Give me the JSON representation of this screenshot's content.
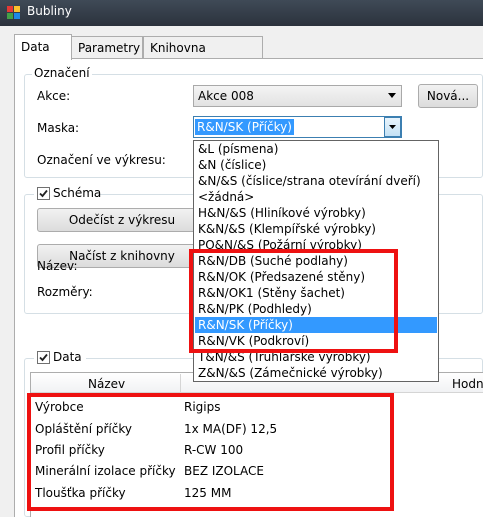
{
  "window": {
    "title": "Bubliny"
  },
  "tabs": [
    "Data",
    "Parametry",
    "Knihovna schémat"
  ],
  "oznaceni": {
    "title": "Označení",
    "akce_label": "Akce:",
    "akce_value": "Akce 008",
    "nova_button": "Nová...",
    "maska_label": "Maska:",
    "maska_value": "R&N/SK (Příčky)",
    "vykres_label": "Označení ve výkresu:"
  },
  "schema": {
    "title": "Schéma",
    "checked": true,
    "odecist_button": "Odečíst z výkresu",
    "nacist_button": "Načíst z knihovny",
    "nazev_label": "Název:",
    "rozmery_label": "Rozměry:"
  },
  "dropdown": {
    "options": [
      "&L (písmena)",
      "&N (číslice)",
      "&N/&S (číslice/strana otevírání dveří)",
      "<žádná>",
      "H&N/&S (Hliníkové výrobky)",
      "K&N/&S (Klempířské výrobky)",
      "PO&N/&S (Požární výrobky)",
      "R&N/DB (Suché podlahy)",
      "R&N/OK (Předsazené stěny)",
      "R&N/OK1 (Stěny šachet)",
      "R&N/PK (Podhledy)",
      "R&N/SK (Příčky)",
      "R&N/VK (Podkroví)",
      "T&N/&S (Truhlářské výrobky)",
      "Z&N/&S (Zámečnické výrobky)"
    ],
    "selected_index": 11
  },
  "data_section": {
    "title": "Data",
    "checked": true,
    "col_name": "Název",
    "col_value_partial": "Hodn",
    "rows": [
      {
        "name": "Výrobce",
        "value": "Rigips"
      },
      {
        "name": "Opláštění příčky",
        "value": "1x MA(DF) 12,5"
      },
      {
        "name": "Profil příčky",
        "value": "R-CW 100"
      },
      {
        "name": "Minerální izolace příčky",
        "value": "BEZ IZOLACE"
      },
      {
        "name": "Tloušťka příčky",
        "value": "125 MM"
      }
    ]
  },
  "colors": {
    "highlight": "#3399ff",
    "annotation_red": "#ee1111",
    "titlebar": "#2b323c"
  }
}
